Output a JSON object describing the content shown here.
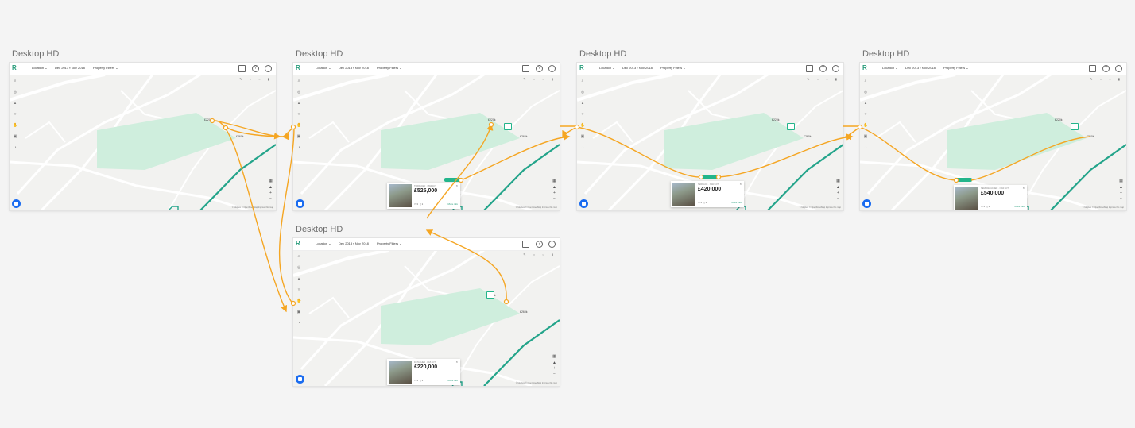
{
  "frames": [
    {
      "id": "f1",
      "title": "Desktop HD",
      "card": null
    },
    {
      "id": "f2",
      "title": "Desktop HD",
      "card": {
        "meta": "TERRACED · NW3 1DT",
        "price": "£525,000",
        "sub": "",
        "beds": "3",
        "baths": "1",
        "more": "More info"
      }
    },
    {
      "id": "f3",
      "title": "Desktop HD",
      "card": {
        "meta": "TERRACE · NW3 1DT",
        "price": "£420,000",
        "sub": "",
        "beds": "3",
        "baths": "1",
        "more": "More info"
      }
    },
    {
      "id": "f4",
      "title": "Desktop HD",
      "card": {
        "meta": "SEMI-DETACHED · NW3 1DT",
        "price": "£540,000",
        "sub": "",
        "beds": "3",
        "baths": "1",
        "more": "More info"
      }
    },
    {
      "id": "f5",
      "title": "Desktop HD",
      "card": {
        "meta": "DETACHED · LG5 1DT",
        "price": "£220,000",
        "sub": "",
        "beds": "3",
        "baths": "1",
        "more": "More info"
      }
    }
  ],
  "topbar": {
    "logo": "R",
    "location_label": "Location",
    "date_from": "Dec 2013",
    "date_to": "Nov 2018",
    "filters_label": "Property Filters"
  },
  "map": {
    "price_labels": [
      "£220k",
      "£260k"
    ],
    "attribution": "© Mapbox © OpenStreetMap  Improve this map",
    "colors": {
      "park": "#cfeedd",
      "road": "#ffffff",
      "rail": "#23a48a",
      "accent": "#23b58b",
      "connector": "#f5a623",
      "chat": "#1a6cf0"
    }
  },
  "icons": {
    "folder": "folder-icon",
    "help": "help-icon",
    "user": "user-icon",
    "chat": "chat-icon"
  }
}
